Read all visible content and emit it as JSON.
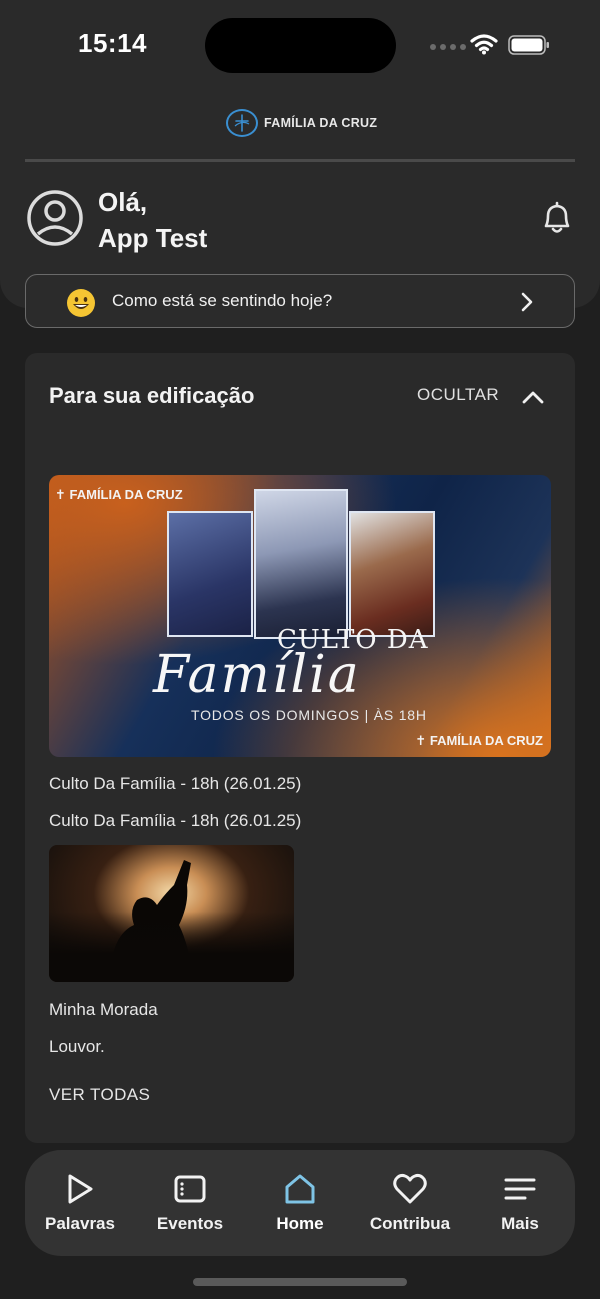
{
  "status": {
    "time": "15:14"
  },
  "brand": {
    "name": "FAMÍLIA DA CRUZ"
  },
  "header": {
    "greeting_line1": "Olá,",
    "greeting_line2": "App Test"
  },
  "mood": {
    "prompt": "Como está se sentindo hoje?",
    "emoji": "😀"
  },
  "section": {
    "title": "Para sua edificação",
    "hide_label": "OCULTAR",
    "see_all": "VER TODAS"
  },
  "banner": {
    "brand_top": "✝ FAMÍLIA DA CRUZ",
    "brand_bottom": "✝ FAMÍLIA DA CRUZ",
    "culto": "CULTO  DA",
    "script": "Família",
    "subtitle": "TODOS OS DOMINGOS |  ÀS 18H"
  },
  "items": [
    {
      "title": "Culto Da Família - 18h (26.01.25)",
      "description": "Culto Da Família - 18h (26.01.25)"
    },
    {
      "title": "Minha Morada",
      "description": "Louvor."
    }
  ],
  "nav": {
    "items": [
      {
        "label": "Palavras",
        "icon": "play-icon",
        "active": false
      },
      {
        "label": "Eventos",
        "icon": "calendar-icon",
        "active": false
      },
      {
        "label": "Home",
        "icon": "home-icon",
        "active": true
      },
      {
        "label": "Contribua",
        "icon": "heart-icon",
        "active": false
      },
      {
        "label": "Mais",
        "icon": "menu-icon",
        "active": false
      }
    ],
    "accent": "#7fc4e6"
  },
  "colors": {
    "background": "#1f1f1f",
    "panel": "#2a2a2a",
    "brand_blue": "#3a8fd1"
  }
}
